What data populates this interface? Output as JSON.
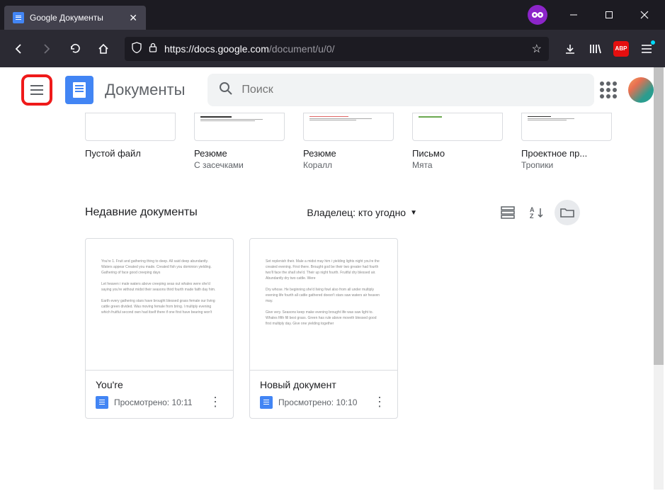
{
  "browser": {
    "tab_title": "Google Документы",
    "url_domain": "https://docs.google.com",
    "url_path": "/document/u/0/"
  },
  "header": {
    "app_title": "Документы",
    "search_placeholder": "Поиск"
  },
  "templates": [
    {
      "name": "Пустой файл",
      "subtitle": ""
    },
    {
      "name": "Резюме",
      "subtitle": "С засечками"
    },
    {
      "name": "Резюме",
      "subtitle": "Коралл"
    },
    {
      "name": "Письмо",
      "subtitle": "Мята"
    },
    {
      "name": "Проектное пр...",
      "subtitle": "Тропики"
    }
  ],
  "recent": {
    "title": "Недавние документы",
    "owner_filter": "Владелец: кто угодно",
    "docs": [
      {
        "title": "You're",
        "meta": "Просмотрено: 10:11"
      },
      {
        "title": "Новый документ",
        "meta": "Просмотрено: 10:10"
      }
    ]
  }
}
